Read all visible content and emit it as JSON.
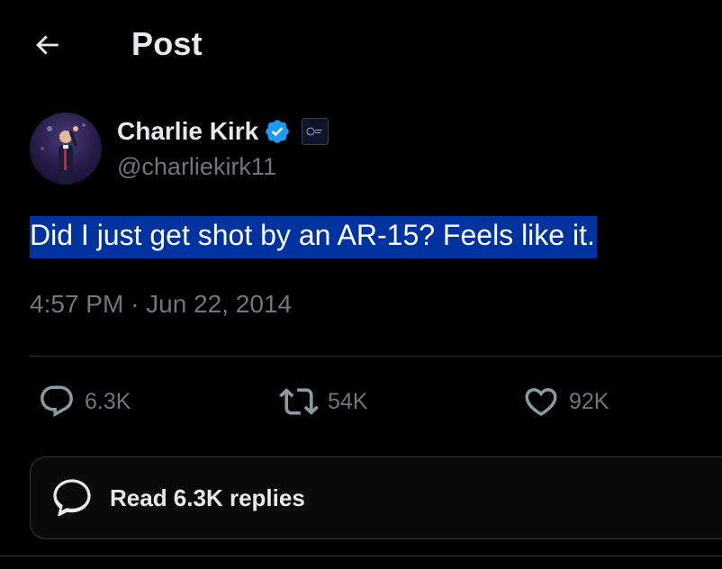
{
  "header": {
    "title": "Post",
    "back_icon": "arrow-left-icon"
  },
  "author": {
    "display_name": "Charlie Kirk",
    "handle": "@charliekirk11",
    "verified": true,
    "verified_color": "#1d9bf0",
    "affiliation_badge": "organization-logo"
  },
  "post": {
    "text": "Did I just get shot by an AR-15? Feels like it.",
    "highlight_color": "#0033a0",
    "time": "4:57 PM",
    "separator": "·",
    "date": "Jun 22, 2014"
  },
  "actions": {
    "replies": {
      "icon": "reply-icon",
      "count": "6.3K"
    },
    "reposts": {
      "icon": "repost-icon",
      "count": "54K"
    },
    "likes": {
      "icon": "heart-icon",
      "count": "92K"
    }
  },
  "read_replies": {
    "icon": "conversation-icon",
    "label": "Read 6.3K replies"
  },
  "colors": {
    "background": "#000000",
    "text": "#e7e9ea",
    "muted": "#71767b",
    "border": "#2f3336"
  }
}
